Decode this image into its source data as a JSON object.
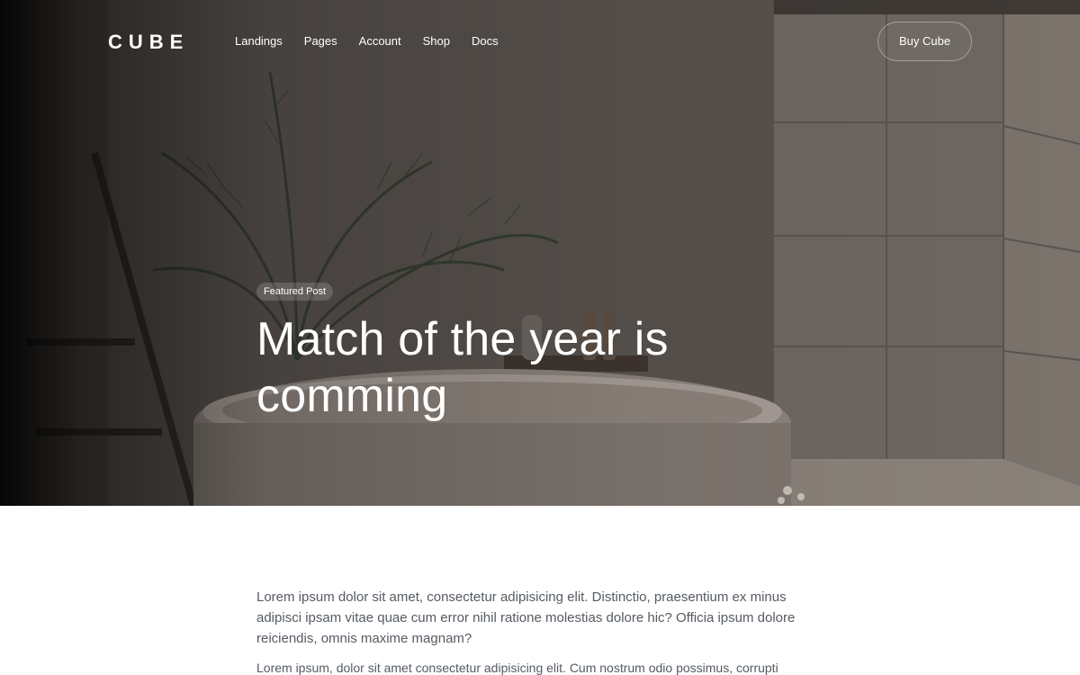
{
  "brand": {
    "logo_text": "CUBE"
  },
  "nav": {
    "items": [
      {
        "label": "Landings"
      },
      {
        "label": "Pages"
      },
      {
        "label": "Account"
      },
      {
        "label": "Shop"
      },
      {
        "label": "Docs"
      }
    ],
    "cta_label": "Buy Cube"
  },
  "hero": {
    "badge": "Featured Post",
    "title": "Match of the year is comming",
    "image_subject": "bathroom-with-oval-bathtub-and-palm-plant"
  },
  "article": {
    "lead": "Lorem ipsum dolor sit amet, consectetur adipisicing elit. Distinctio, praesentium ex minus adipisci ipsam vitae quae cum error nihil ratione molestias dolore hic? Officia ipsum dolore reiciendis, omnis maxime magnam?",
    "paragraph_2": "Lorem ipsum, dolor sit amet consectetur adipisicing elit. Cum nostrum odio possimus, corrupti"
  },
  "colors": {
    "hero_overlay": "#000000",
    "nav_text": "#ffffff",
    "body_text": "#555b62",
    "page_background": "#ffffff"
  }
}
